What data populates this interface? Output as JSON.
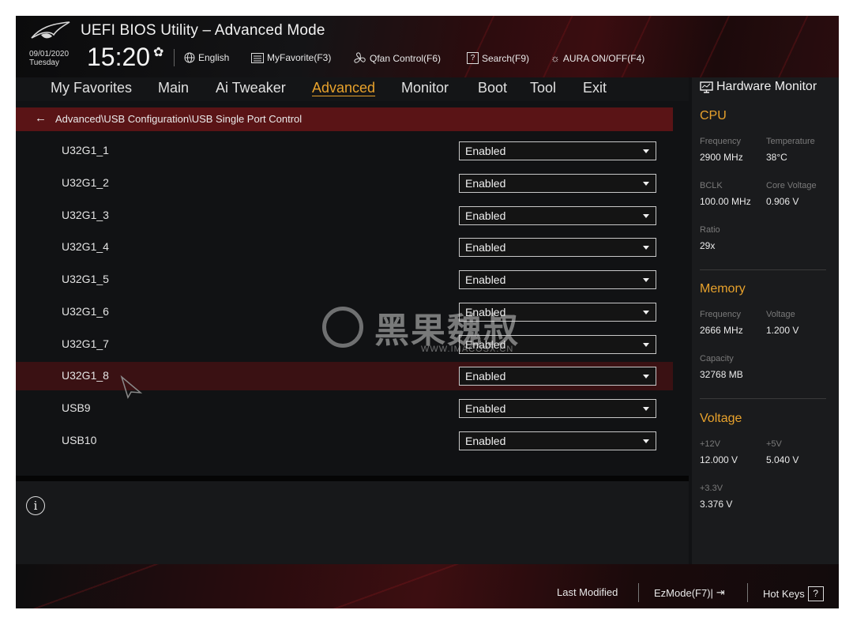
{
  "header": {
    "title": "UEFI BIOS Utility – Advanced Mode",
    "date": "09/01/2020",
    "weekday": "Tuesday",
    "time": "15:20",
    "language": "English",
    "myfavorite": "MyFavorite(F3)",
    "qfan": "Qfan Control(F6)",
    "search": "Search(F9)",
    "aura": "AURA ON/OFF(F4)"
  },
  "nav": {
    "tabs": [
      "My Favorites",
      "Main",
      "Ai Tweaker",
      "Advanced",
      "Monitor",
      "Boot",
      "Tool",
      "Exit"
    ],
    "active": "Advanced"
  },
  "breadcrumb": "Advanced\\USB Configuration\\USB Single Port Control",
  "settings": [
    {
      "label": "U32G1_1",
      "value": "Enabled"
    },
    {
      "label": "U32G1_2",
      "value": "Enabled"
    },
    {
      "label": "U32G1_3",
      "value": "Enabled"
    },
    {
      "label": "U32G1_4",
      "value": "Enabled"
    },
    {
      "label": "U32G1_5",
      "value": "Enabled"
    },
    {
      "label": "U32G1_6",
      "value": "Enabled"
    },
    {
      "label": "U32G1_7",
      "value": "Enabled"
    },
    {
      "label": "U32G1_8",
      "value": "Enabled"
    },
    {
      "label": "USB9",
      "value": "Enabled"
    },
    {
      "label": "USB10",
      "value": "Enabled"
    }
  ],
  "selected_setting": "U32G1_8",
  "hardware_monitor": {
    "title": "Hardware Monitor",
    "cpu": {
      "heading": "CPU",
      "frequency_label": "Frequency",
      "frequency": "2900 MHz",
      "temperature_label": "Temperature",
      "temperature": "38°C",
      "bclk_label": "BCLK",
      "bclk": "100.00 MHz",
      "core_voltage_label": "Core Voltage",
      "core_voltage": "0.906 V",
      "ratio_label": "Ratio",
      "ratio": "29x"
    },
    "memory": {
      "heading": "Memory",
      "frequency_label": "Frequency",
      "frequency": "2666 MHz",
      "voltage_label": "Voltage",
      "voltage": "1.200 V",
      "capacity_label": "Capacity",
      "capacity": "32768 MB"
    },
    "voltage": {
      "heading": "Voltage",
      "v12_label": "+12V",
      "v12": "12.000 V",
      "v5_label": "+5V",
      "v5": "5.040 V",
      "v33_label": "+3.3V",
      "v33": "3.376 V"
    }
  },
  "footer": {
    "last_modified": "Last Modified",
    "ezmode": "EzMode(F7)|",
    "hotkeys": "Hot Keys",
    "hotkeys_icon": "?"
  },
  "watermark": {
    "text": "黑果魏叔",
    "subtext": "WWW.IMACOSX.CN"
  },
  "colors": {
    "accent": "#e8a22c",
    "breadcrumb_bg": "#5a1416",
    "selected_row_bg": "#3a1113",
    "background": "#111214"
  }
}
